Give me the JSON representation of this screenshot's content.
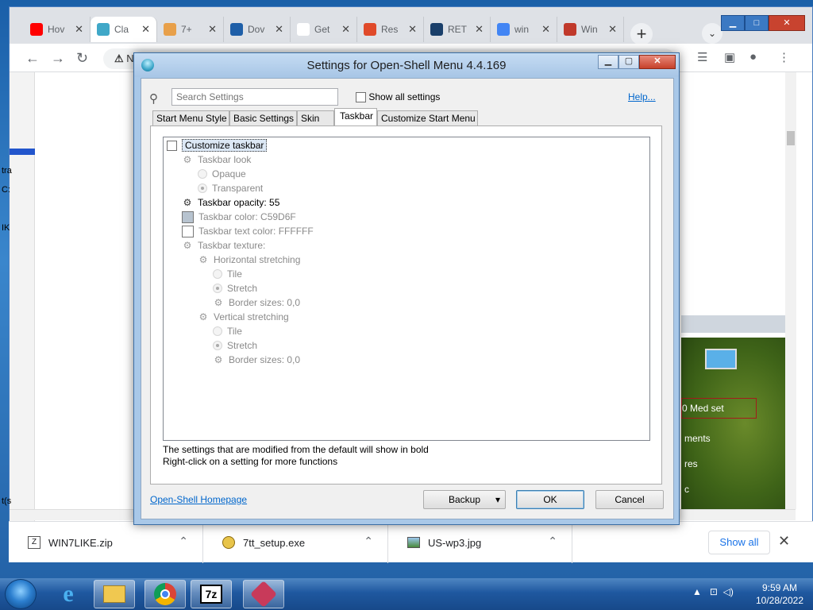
{
  "browser": {
    "tabs": [
      {
        "label": "Hov",
        "color": "#ff0000"
      },
      {
        "label": "Cla",
        "color": "#40a8c8"
      },
      {
        "label": "7+",
        "color": "#e8a04a"
      },
      {
        "label": "Dov",
        "color": "#1f5fa8"
      },
      {
        "label": "Get",
        "color": "#ffffff"
      },
      {
        "label": "Res",
        "color": "#e04a2a"
      },
      {
        "label": "RET",
        "color": "#1a3f6a"
      },
      {
        "label": "win",
        "color": "#4285f4"
      },
      {
        "label": "Win",
        "color": "#c0392b"
      }
    ],
    "omnibox_text": "N",
    "green_panel": {
      "item1": "0 Med set",
      "item2": "ments",
      "item3": "res",
      "item4": "c"
    },
    "left_edge": {
      "t1": "tra",
      "t2": "C:",
      "t3": "IK",
      "t4": "t(s"
    }
  },
  "dialog": {
    "title": "Settings for Open-Shell Menu 4.4.169",
    "search_placeholder": "Search Settings",
    "show_all_label": "Show all settings",
    "help_link": "Help...",
    "tabs": [
      "Start Menu Style",
      "Basic Settings",
      "Skin",
      "Taskbar",
      "Customize Start Menu"
    ],
    "active_tab": "Taskbar",
    "tree": [
      {
        "label": "Customize taskbar",
        "type": "checkbox",
        "checked": false,
        "state": "focus"
      },
      {
        "label": "Taskbar look",
        "type": "gear",
        "state": "disabled"
      },
      {
        "label": "Opaque",
        "type": "radio",
        "checked": false,
        "state": "disabled"
      },
      {
        "label": "Transparent",
        "type": "radio",
        "checked": true,
        "state": "disabled"
      },
      {
        "label": "Taskbar opacity: 55",
        "type": "gear",
        "state": "bold"
      },
      {
        "label": "Taskbar color: C59D6F",
        "type": "swatch",
        "swatch_color": "#b7c3cf",
        "state": "disabled"
      },
      {
        "label": "Taskbar text color: FFFFFF",
        "type": "swatch",
        "swatch_color": "#ffffff",
        "state": "disabled"
      },
      {
        "label": "Taskbar texture:",
        "type": "gear",
        "state": "disabled"
      },
      {
        "label": "Horizontal stretching",
        "type": "gear",
        "state": "disabled"
      },
      {
        "label": "Tile",
        "type": "radio",
        "checked": false,
        "state": "disabled"
      },
      {
        "label": "Stretch",
        "type": "radio",
        "checked": true,
        "state": "disabled"
      },
      {
        "label": "Border sizes: 0,0",
        "type": "gear",
        "state": "disabled"
      },
      {
        "label": "Vertical stretching",
        "type": "gear",
        "state": "disabled"
      },
      {
        "label": "Tile",
        "type": "radio",
        "checked": false,
        "state": "disabled"
      },
      {
        "label": "Stretch",
        "type": "radio",
        "checked": true,
        "state": "disabled"
      },
      {
        "label": "Border sizes: 0,0",
        "type": "gear",
        "state": "disabled"
      }
    ],
    "note_line1": "The settings that are modified from the default will show in bold",
    "note_line2": "Right-click on a setting for more functions",
    "homepage_link": "Open-Shell Homepage",
    "backup_label": "Backup",
    "ok_label": "OK",
    "cancel_label": "Cancel"
  },
  "downloads": {
    "items": [
      {
        "name": "WIN7LIKE.zip"
      },
      {
        "name": "7tt_setup.exe"
      },
      {
        "name": "US-wp3.jpg"
      }
    ],
    "show_all": "Show all",
    "close_glyph": "✕"
  },
  "taskbar": {
    "apps": [
      "internet-explorer",
      "file-explorer",
      "chrome",
      "7-zip",
      "open-shell"
    ],
    "zip_label": "7z",
    "clock_time": "9:59 AM",
    "clock_date": "10/28/2022"
  }
}
